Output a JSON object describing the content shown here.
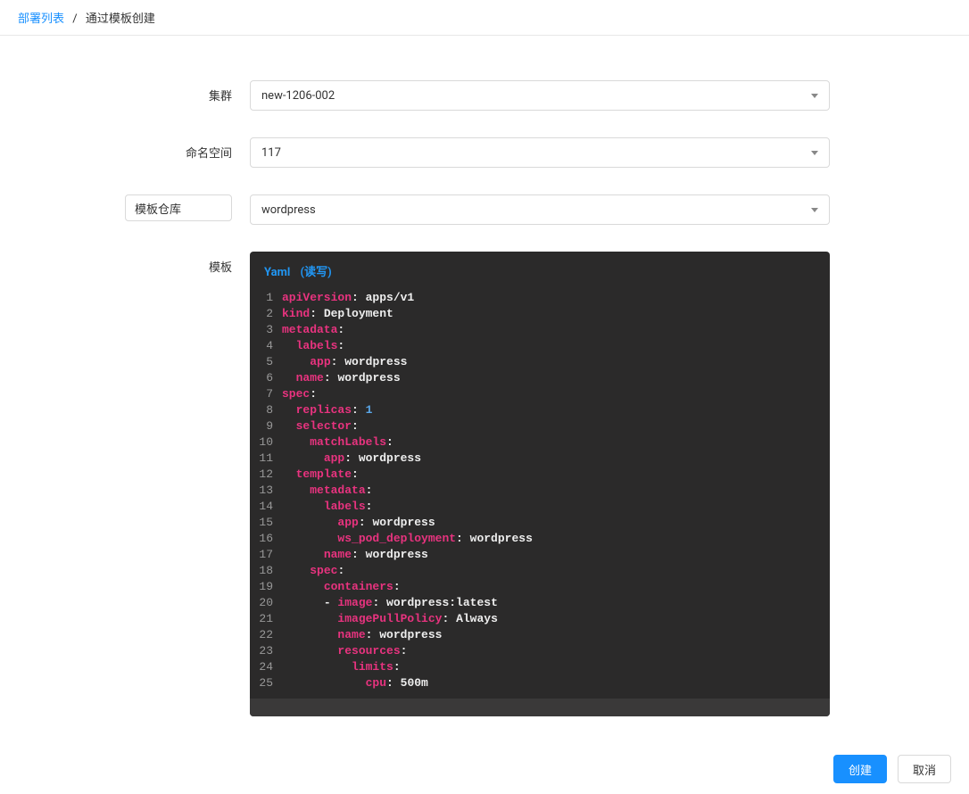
{
  "breadcrumb": {
    "link": "部署列表",
    "current": "通过模板创建"
  },
  "labels": {
    "cluster": "集群",
    "namespace": "命名空间",
    "templateRepo": "模板仓库",
    "template": "模板"
  },
  "values": {
    "cluster": "new-1206-002",
    "namespace": "117",
    "wordpress": "wordpress"
  },
  "editor": {
    "title": "Yaml",
    "mode": "(读写)"
  },
  "yaml": [
    {
      "n": "1",
      "tokens": [
        {
          "t": "key",
          "v": "apiVersion"
        },
        {
          "t": "p",
          "v": ": "
        },
        {
          "t": "val",
          "v": "apps/v1"
        }
      ]
    },
    {
      "n": "2",
      "tokens": [
        {
          "t": "key",
          "v": "kind"
        },
        {
          "t": "p",
          "v": ": "
        },
        {
          "t": "val",
          "v": "Deployment"
        }
      ]
    },
    {
      "n": "3",
      "tokens": [
        {
          "t": "key",
          "v": "metadata"
        },
        {
          "t": "p",
          "v": ":"
        }
      ]
    },
    {
      "n": "4",
      "tokens": [
        {
          "t": "sp",
          "v": "  "
        },
        {
          "t": "key",
          "v": "labels"
        },
        {
          "t": "p",
          "v": ":"
        }
      ]
    },
    {
      "n": "5",
      "tokens": [
        {
          "t": "sp",
          "v": "    "
        },
        {
          "t": "key",
          "v": "app"
        },
        {
          "t": "p",
          "v": ": "
        },
        {
          "t": "val",
          "v": "wordpress"
        }
      ]
    },
    {
      "n": "6",
      "tokens": [
        {
          "t": "sp",
          "v": "  "
        },
        {
          "t": "key",
          "v": "name"
        },
        {
          "t": "p",
          "v": ": "
        },
        {
          "t": "val",
          "v": "wordpress"
        }
      ]
    },
    {
      "n": "7",
      "tokens": [
        {
          "t": "key",
          "v": "spec"
        },
        {
          "t": "p",
          "v": ":"
        }
      ]
    },
    {
      "n": "8",
      "tokens": [
        {
          "t": "sp",
          "v": "  "
        },
        {
          "t": "key",
          "v": "replicas"
        },
        {
          "t": "p",
          "v": ": "
        },
        {
          "t": "num",
          "v": "1"
        }
      ]
    },
    {
      "n": "9",
      "tokens": [
        {
          "t": "sp",
          "v": "  "
        },
        {
          "t": "key",
          "v": "selector"
        },
        {
          "t": "p",
          "v": ":"
        }
      ]
    },
    {
      "n": "10",
      "tokens": [
        {
          "t": "sp",
          "v": "    "
        },
        {
          "t": "key",
          "v": "matchLabels"
        },
        {
          "t": "p",
          "v": ":"
        }
      ]
    },
    {
      "n": "11",
      "tokens": [
        {
          "t": "sp",
          "v": "      "
        },
        {
          "t": "key",
          "v": "app"
        },
        {
          "t": "p",
          "v": ": "
        },
        {
          "t": "val",
          "v": "wordpress"
        }
      ]
    },
    {
      "n": "12",
      "tokens": [
        {
          "t": "sp",
          "v": "  "
        },
        {
          "t": "key",
          "v": "template"
        },
        {
          "t": "p",
          "v": ":"
        }
      ]
    },
    {
      "n": "13",
      "tokens": [
        {
          "t": "sp",
          "v": "    "
        },
        {
          "t": "key",
          "v": "metadata"
        },
        {
          "t": "p",
          "v": ":"
        }
      ]
    },
    {
      "n": "14",
      "tokens": [
        {
          "t": "sp",
          "v": "      "
        },
        {
          "t": "key",
          "v": "labels"
        },
        {
          "t": "p",
          "v": ":"
        }
      ]
    },
    {
      "n": "15",
      "tokens": [
        {
          "t": "sp",
          "v": "        "
        },
        {
          "t": "key",
          "v": "app"
        },
        {
          "t": "p",
          "v": ": "
        },
        {
          "t": "val",
          "v": "wordpress"
        }
      ]
    },
    {
      "n": "16",
      "tokens": [
        {
          "t": "sp",
          "v": "        "
        },
        {
          "t": "key",
          "v": "ws_pod_deployment"
        },
        {
          "t": "p",
          "v": ": "
        },
        {
          "t": "val",
          "v": "wordpress"
        }
      ]
    },
    {
      "n": "17",
      "tokens": [
        {
          "t": "sp",
          "v": "      "
        },
        {
          "t": "key",
          "v": "name"
        },
        {
          "t": "p",
          "v": ": "
        },
        {
          "t": "val",
          "v": "wordpress"
        }
      ]
    },
    {
      "n": "18",
      "tokens": [
        {
          "t": "sp",
          "v": "    "
        },
        {
          "t": "key",
          "v": "spec"
        },
        {
          "t": "p",
          "v": ":"
        }
      ]
    },
    {
      "n": "19",
      "tokens": [
        {
          "t": "sp",
          "v": "      "
        },
        {
          "t": "key",
          "v": "containers"
        },
        {
          "t": "p",
          "v": ":"
        }
      ]
    },
    {
      "n": "20",
      "tokens": [
        {
          "t": "sp",
          "v": "      "
        },
        {
          "t": "dash",
          "v": "- "
        },
        {
          "t": "key",
          "v": "image"
        },
        {
          "t": "p",
          "v": ": "
        },
        {
          "t": "val",
          "v": "wordpress:latest"
        }
      ]
    },
    {
      "n": "21",
      "tokens": [
        {
          "t": "sp",
          "v": "        "
        },
        {
          "t": "key",
          "v": "imagePullPolicy"
        },
        {
          "t": "p",
          "v": ": "
        },
        {
          "t": "val",
          "v": "Always"
        }
      ]
    },
    {
      "n": "22",
      "tokens": [
        {
          "t": "sp",
          "v": "        "
        },
        {
          "t": "key",
          "v": "name"
        },
        {
          "t": "p",
          "v": ": "
        },
        {
          "t": "val",
          "v": "wordpress"
        }
      ]
    },
    {
      "n": "23",
      "tokens": [
        {
          "t": "sp",
          "v": "        "
        },
        {
          "t": "key",
          "v": "resources"
        },
        {
          "t": "p",
          "v": ":"
        }
      ]
    },
    {
      "n": "24",
      "tokens": [
        {
          "t": "sp",
          "v": "          "
        },
        {
          "t": "key",
          "v": "limits"
        },
        {
          "t": "p",
          "v": ":"
        }
      ]
    },
    {
      "n": "25",
      "tokens": [
        {
          "t": "sp",
          "v": "            "
        },
        {
          "t": "key",
          "v": "cpu"
        },
        {
          "t": "p",
          "v": ": "
        },
        {
          "t": "val",
          "v": "500m"
        }
      ]
    }
  ],
  "buttons": {
    "create": "创建",
    "cancel": "取消"
  }
}
